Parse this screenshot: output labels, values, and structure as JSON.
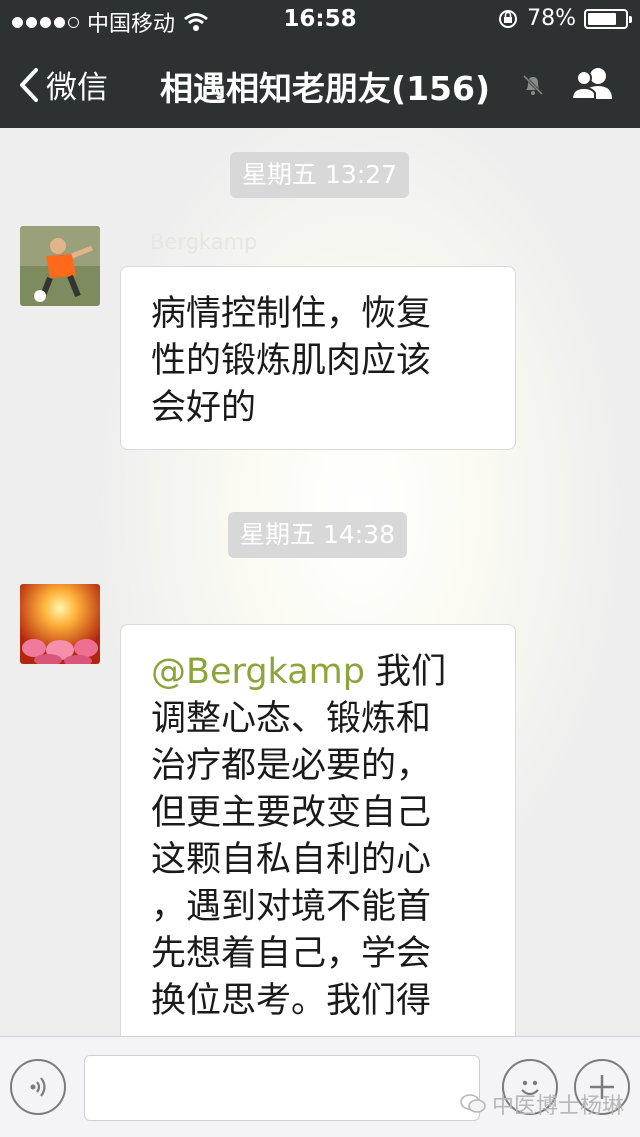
{
  "status_bar": {
    "carrier": "中国移动",
    "time": "16:58",
    "battery_percent": "78%",
    "battery_level": 0.78
  },
  "nav": {
    "back_label": "微信",
    "title": "相遇相知老朋友(156)",
    "icons": [
      "back-chevron-icon",
      "mute-bell-icon",
      "group-members-icon"
    ]
  },
  "messages": [
    {
      "timestamp": "星期五 13:27",
      "sender": "Bergkamp",
      "lines": [
        "病情控制住，恢复",
        "性的锻炼肌肉应该",
        "会好的"
      ]
    },
    {
      "timestamp": "星期五 14:38",
      "sender": "",
      "mention": "@Bergkamp",
      "first_line_rest": " 我们",
      "lines": [
        "调整心态、锻炼和",
        "治疗都是必要的，",
        "但更主要改变自己",
        "这颗自私自利的心",
        "，遇到对境不能首",
        "先想着自己，学会",
        "换位思考。我们得"
      ]
    }
  ],
  "input_bar": {
    "icons": [
      "voice-icon",
      "emoji-icon",
      "plus-icon"
    ]
  },
  "watermark": "中医博士杨琳",
  "colors": {
    "nav_bg": "#2e3132",
    "mention": "#8aa53a",
    "bubble_bg": "#ffffff"
  }
}
